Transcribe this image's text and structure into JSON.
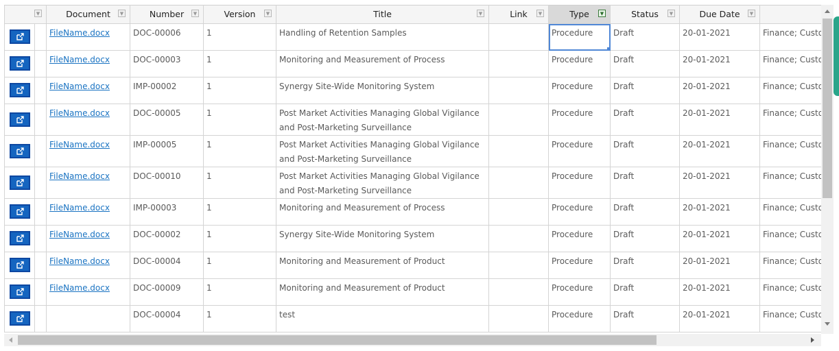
{
  "columns": [
    {
      "label": "",
      "filter": true
    },
    {
      "label": "Document",
      "filter": true
    },
    {
      "label": "Number",
      "filter": true
    },
    {
      "label": "Version",
      "filter": true
    },
    {
      "label": "Title",
      "filter": true
    },
    {
      "label": "Link",
      "filter": true
    },
    {
      "label": "Type",
      "filter": true,
      "active": true
    },
    {
      "label": "Status",
      "filter": true
    },
    {
      "label": "Due Date",
      "filter": true
    },
    {
      "label": "",
      "filter": false
    }
  ],
  "rows": [
    {
      "document": "FileName.docx",
      "number": "DOC-00006",
      "version": "1",
      "title": "Handling of Retention Samples",
      "link": "",
      "type": "Procedure",
      "status": "Draft",
      "due_date": "20-01-2021",
      "extra": "Finance; Customer"
    },
    {
      "document": "FileName.docx",
      "number": "DOC-00003",
      "version": "1",
      "title": "Monitoring and Measurement of Process",
      "link": "",
      "type": "Procedure",
      "status": "Draft",
      "due_date": "20-01-2021",
      "extra": "Finance; Customer"
    },
    {
      "document": "FileName.docx",
      "number": "IMP-00002",
      "version": "1",
      "title": "Synergy Site-Wide Monitoring System",
      "link": "",
      "type": "Procedure",
      "status": "Draft",
      "due_date": "20-01-2021",
      "extra": "Finance; Customer"
    },
    {
      "document": "FileName.docx",
      "number": "DOC-00005",
      "version": "1",
      "title": "Post Market Activities Managing Global Vigilance and Post-Marketing Surveillance",
      "link": "",
      "type": "Procedure",
      "status": "Draft",
      "due_date": "20-01-2021",
      "extra": "Finance; Customer"
    },
    {
      "document": "FileName.docx",
      "number": "IMP-00005",
      "version": "1",
      "title": "Post Market Activities Managing Global Vigilance and Post-Marketing Surveillance",
      "link": "",
      "type": "Procedure",
      "status": "Draft",
      "due_date": "20-01-2021",
      "extra": "Finance; Customer"
    },
    {
      "document": "FileName.docx",
      "number": "DOC-00010",
      "version": "1",
      "title": "Post Market Activities Managing Global Vigilance and Post-Marketing Surveillance",
      "link": "",
      "type": "Procedure",
      "status": "Draft",
      "due_date": "20-01-2021",
      "extra": "Finance; Customer"
    },
    {
      "document": "FileName.docx",
      "number": "IMP-00003",
      "version": "1",
      "title": "Monitoring and Measurement of Process",
      "link": "",
      "type": "Procedure",
      "status": "Draft",
      "due_date": "20-01-2021",
      "extra": "Finance; Customer"
    },
    {
      "document": "FileName.docx",
      "number": "DOC-00002",
      "version": "1",
      "title": "Synergy Site-Wide Monitoring System",
      "link": "",
      "type": "Procedure",
      "status": "Draft",
      "due_date": "20-01-2021",
      "extra": "Finance; Customer"
    },
    {
      "document": "FileName.docx",
      "number": "DOC-00004",
      "version": "1",
      "title": "Monitoring and Measurement of Product",
      "link": "",
      "type": "Procedure",
      "status": "Draft",
      "due_date": "20-01-2021",
      "extra": "Finance; Customer"
    },
    {
      "document": "FileName.docx",
      "number": "DOC-00009",
      "version": "1",
      "title": "Monitoring and Measurement of Product",
      "link": "",
      "type": "Procedure",
      "status": "Draft",
      "due_date": "20-01-2021",
      "extra": "Finance; Customer"
    },
    {
      "document": "",
      "number": "DOC-00004",
      "version": "1",
      "title": "test",
      "link": "",
      "type": "Procedure",
      "status": "Draft",
      "due_date": "20-01-2021",
      "extra": "Finance; Customer"
    }
  ],
  "icons": {
    "open_button": "external-link-icon",
    "filter": "filter-dropdown-icon"
  },
  "colors": {
    "button": "#1565c0",
    "link": "#1a73c2",
    "selection": "#4f87d6",
    "side_tab": "#2aa58a"
  }
}
